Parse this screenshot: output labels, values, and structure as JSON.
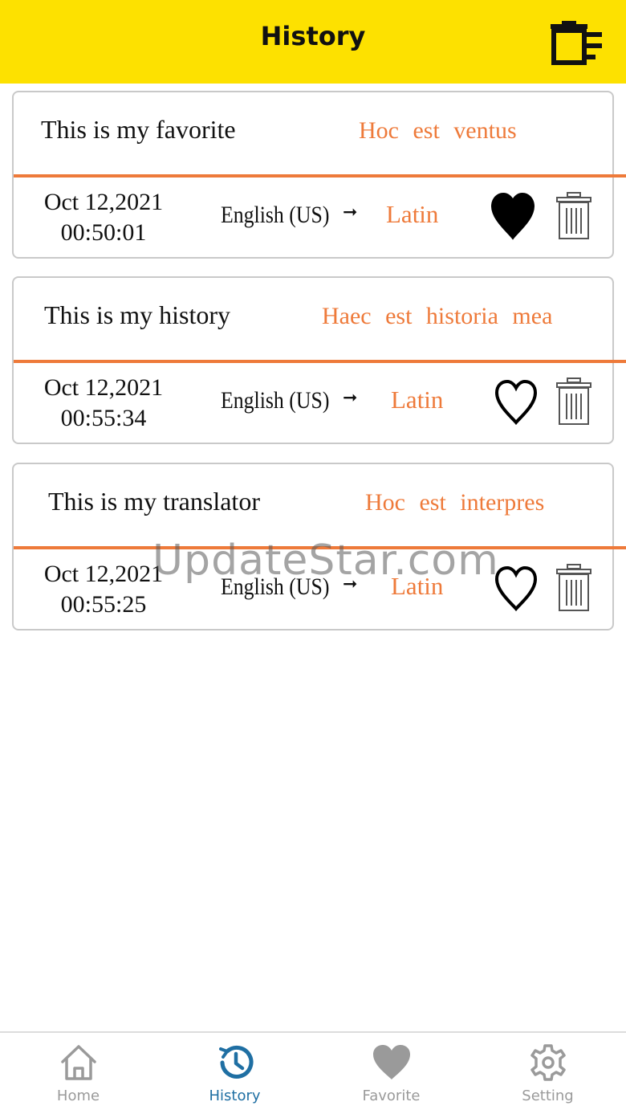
{
  "header": {
    "title": "History",
    "clear_icon": "trash-list-icon"
  },
  "entries": [
    {
      "source_text": "This is my favorite",
      "translation": "Hoc est ventus",
      "date": "Oct 12,2021",
      "time": "00:50:01",
      "source_language": "English (US)",
      "target_language": "Latin",
      "favorite": true
    },
    {
      "source_text": "This is my history",
      "translation": "Haec est historia mea",
      "date": "Oct 12,2021",
      "time": "00:55:34",
      "source_language": "English (US)",
      "target_language": "Latin",
      "favorite": false
    },
    {
      "source_text": "This is my translator",
      "translation": "Hoc est interpres",
      "date": "Oct 12,2021",
      "time": "00:55:25",
      "source_language": "English (US)",
      "target_language": "Latin",
      "favorite": false
    }
  ],
  "arrow_glyph": "➞",
  "watermark": "UpdateStar.com",
  "tabs": [
    {
      "label": "Home",
      "icon": "home-icon",
      "active": false
    },
    {
      "label": "History",
      "icon": "history-icon",
      "active": true
    },
    {
      "label": "Favorite",
      "icon": "heart-icon",
      "active": false
    },
    {
      "label": "Setting",
      "icon": "gear-icon",
      "active": false
    }
  ],
  "colors": {
    "header_bg": "#fde100",
    "accent_orange": "#ee7a3a",
    "tab_active": "#1f6fa3",
    "tab_inactive": "#9a9a9a"
  }
}
